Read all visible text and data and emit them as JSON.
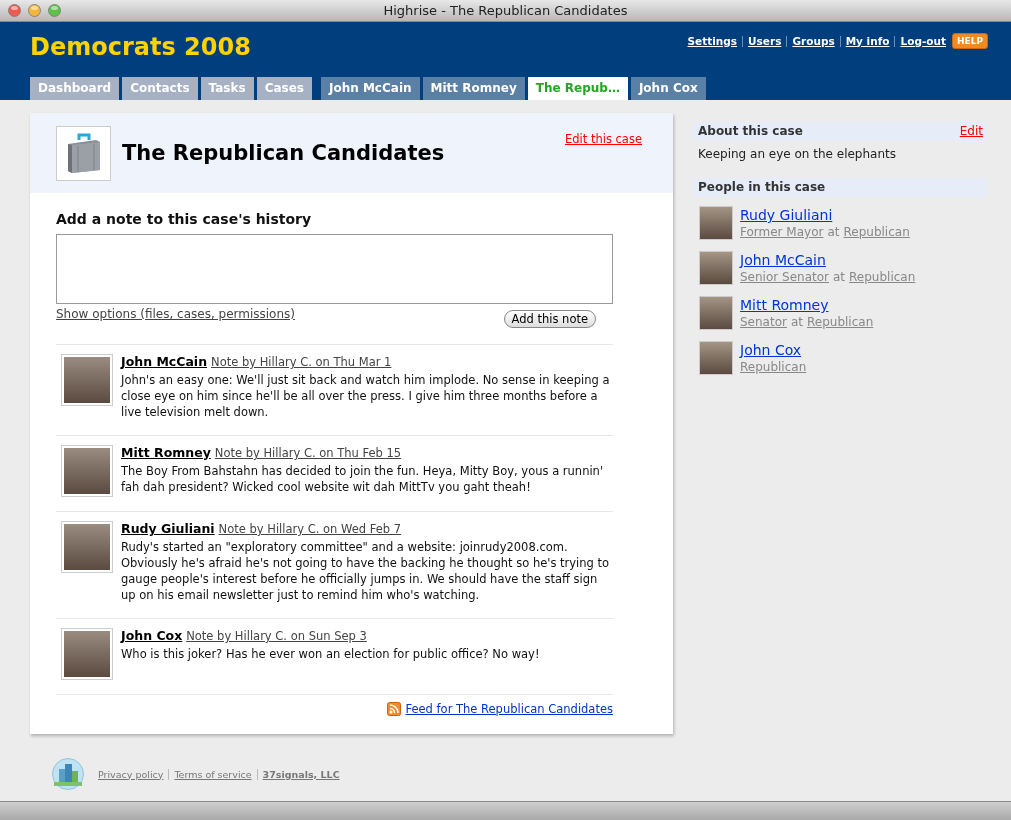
{
  "window": {
    "title": "Highrise - The Republican Candidates"
  },
  "header": {
    "account": "Democrats 2008",
    "links": [
      "Settings",
      "Users",
      "Groups",
      "My info",
      "Log-out"
    ],
    "help": "HELP"
  },
  "tabs": [
    {
      "label": "Dashboard",
      "kind": "section",
      "selected": false
    },
    {
      "label": "Contacts",
      "kind": "section",
      "selected": false
    },
    {
      "label": "Tasks",
      "kind": "section",
      "selected": false
    },
    {
      "label": "Cases",
      "kind": "section",
      "selected": false
    },
    {
      "label": "John McCain",
      "kind": "recent",
      "selected": false
    },
    {
      "label": "Mitt Romney",
      "kind": "recent",
      "selected": false
    },
    {
      "label": "The Repub…",
      "kind": "recent",
      "selected": true
    },
    {
      "label": "John Cox",
      "kind": "recent",
      "selected": false
    }
  ],
  "case": {
    "title": "The Republican Candidates",
    "edit_link": "Edit this case"
  },
  "note_form": {
    "heading": "Add a note to this case's history",
    "options_link": "Show options (files, cases, permissions)",
    "button": "Add this note"
  },
  "notes": [
    {
      "person": "John McCain",
      "meta": "Note by Hillary C. on Thu Mar 1",
      "body": "John's an easy one: We'll just sit back and watch him implode. No sense in keeping a close eye on him since he'll be all over the press. I give him three months before a live television melt down."
    },
    {
      "person": "Mitt Romney",
      "meta": "Note by Hillary C. on Thu Feb 15",
      "body": "The Boy From Bahstahn has decided to join the fun. Heya, Mitty Boy, yous a runnin' fah dah president? Wicked cool website wit dah MittTv you gaht theah!"
    },
    {
      "person": "Rudy Giuliani",
      "meta": "Note by Hillary C. on Wed Feb 7",
      "body": "Rudy's started an \"exploratory committee\" and a website: joinrudy2008.com. Obviously he's afraid he's not going to have the backing he thought so he's trying to gauge people's interest before he officially jumps in. We should have the staff sign up on his email newsletter just to remind him who's watching."
    },
    {
      "person": "John Cox",
      "meta": "Note by Hillary C. on Sun Sep 3",
      "body": "Who is this joker? Has he ever won an election for public office? No way!"
    }
  ],
  "feed_link": "Feed for The Republican Candidates",
  "sidebar": {
    "about": {
      "heading": "About this case",
      "edit": "Edit",
      "text": "Keeping an eye on the elephants"
    },
    "people_heading": "People in this case",
    "people": [
      {
        "name": "Rudy Giuliani",
        "title": "Former Mayor",
        "connector": "at",
        "company": "Republican"
      },
      {
        "name": "John McCain",
        "title": "Senior Senator",
        "connector": "at",
        "company": "Republican"
      },
      {
        "name": "Mitt Romney",
        "title": "Senator",
        "connector": "at",
        "company": "Republican"
      },
      {
        "name": "John Cox",
        "company": "Republican"
      }
    ]
  },
  "footer": {
    "links": [
      "Privacy policy",
      "Terms of service",
      "37signals, LLC"
    ]
  }
}
